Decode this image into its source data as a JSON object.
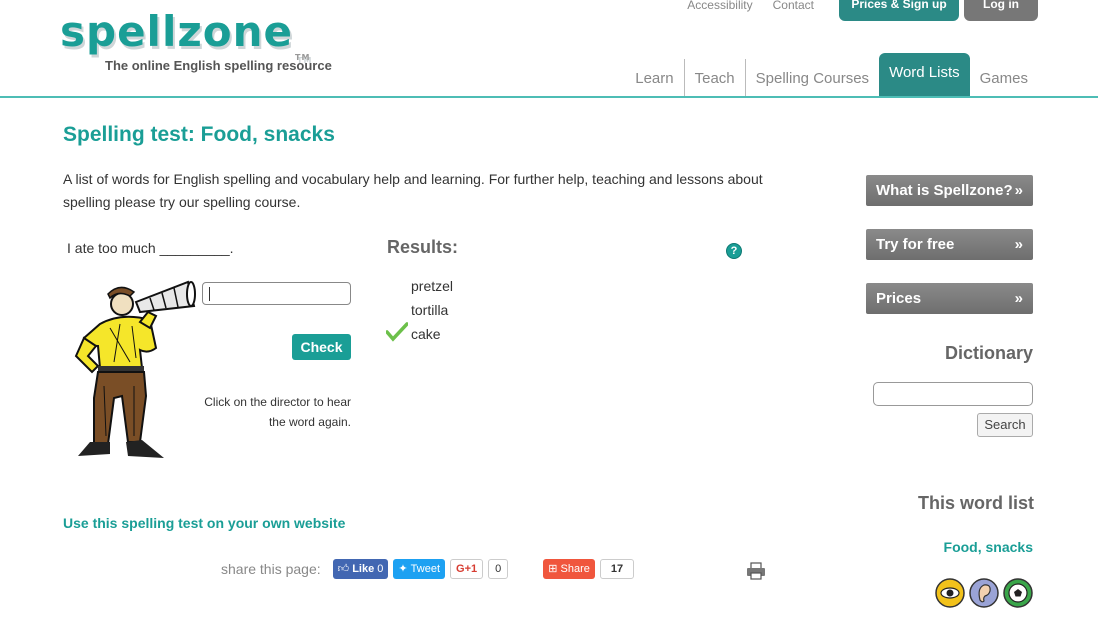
{
  "header": {
    "logo_text": "spellzone",
    "logo_tm": "TM",
    "tagline": "The online English spelling resource",
    "util_links": [
      "Accessibility",
      "Contact"
    ],
    "prices_button": "Prices & Sign up",
    "login_button": "Log in",
    "nav": [
      {
        "label": "Learn",
        "active": false
      },
      {
        "label": "Teach",
        "active": false
      },
      {
        "label": "Spelling Courses",
        "active": false
      },
      {
        "label": "Word Lists",
        "active": true
      },
      {
        "label": "Games",
        "active": false
      }
    ]
  },
  "main": {
    "title": "Spelling test: Food, snacks",
    "intro": "A list of words for English spelling and vocabulary help and learning. For further help, teaching and lessons about spelling please try our spelling course.",
    "sentence": "I ate too much _________.",
    "answer_value": "",
    "check_button": "Check",
    "hint": "Click on the director to hear the word again.",
    "results_title": "Results:",
    "help_icon_text": "?",
    "results": [
      {
        "word": "pretzel",
        "correct": false
      },
      {
        "word": "tortilla",
        "correct": false
      },
      {
        "word": "cake",
        "correct": true
      }
    ],
    "embed_link": "Use this spelling test on your own website",
    "share": {
      "label": "share this page:",
      "facebook_label": "Like",
      "facebook_count": "0",
      "twitter_label": "Tweet",
      "gplus_label": "G+1",
      "gplus_count": "0",
      "share_label": "Share",
      "share_count": "17"
    }
  },
  "sidebar": {
    "buttons": [
      {
        "label": "What is Spellzone?",
        "arrow": "»"
      },
      {
        "label": "Try for free",
        "arrow": "»"
      },
      {
        "label": "Prices",
        "arrow": "»"
      }
    ],
    "dictionary_title": "Dictionary",
    "dictionary_value": "",
    "search_button": "Search",
    "wordlist_title": "This word list",
    "wordlist_link": "Food, snacks",
    "icons": [
      "eye-icon",
      "ear-icon",
      "football-icon"
    ]
  },
  "colors": {
    "accent": "#1a9e96",
    "nav_active": "#2b8a86",
    "tick": "#6cc04a"
  }
}
